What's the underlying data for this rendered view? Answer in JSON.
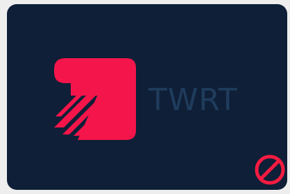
{
  "brand": {
    "wordmark": "TWRT"
  },
  "colors": {
    "card_background": "#0e1f37",
    "logo_accent": "#f4154a",
    "wordmark": "#203c5c",
    "blocked_badge": "#f51b41",
    "page_background": "#eeeeef"
  },
  "icons": {
    "logo": "arrow-speed-logo-icon",
    "blocked": "no-entry-icon"
  }
}
